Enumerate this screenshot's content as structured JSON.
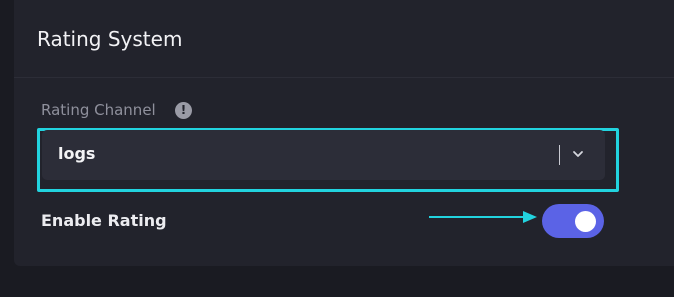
{
  "panel": {
    "title": "Rating System"
  },
  "rating_channel": {
    "label": "Rating Channel",
    "info_icon": "info-circle-icon",
    "value": "logs",
    "dropdown_icon": "chevron-down-icon"
  },
  "enable_rating": {
    "label": "Enable Rating",
    "enabled": true,
    "toggle_color": "#5b63e6"
  },
  "annotations": {
    "highlight_color": "#22d3df",
    "arrow_icon": "arrow-right-icon"
  }
}
